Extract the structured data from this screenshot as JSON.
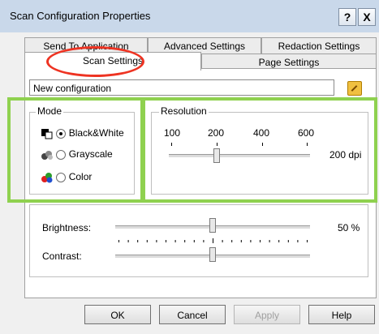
{
  "window": {
    "title": "Scan Configuration Properties",
    "help_label": "?",
    "close_label": "X"
  },
  "tabs": {
    "row1": [
      "Send To Application",
      "Advanced Settings",
      "Redaction Settings"
    ],
    "row2": [
      "Scan Settings",
      "Page Settings"
    ],
    "active": "Scan Settings"
  },
  "config_name": "New configuration",
  "mode": {
    "legend": "Mode",
    "options": [
      {
        "label": "Black&White",
        "selected": true,
        "icon": "bw-scan-icon"
      },
      {
        "label": "Grayscale",
        "selected": false,
        "icon": "grayscale-scan-icon"
      },
      {
        "label": "Color",
        "selected": false,
        "icon": "color-scan-icon"
      }
    ]
  },
  "resolution": {
    "legend": "Resolution",
    "tick_labels": [
      "100",
      "200",
      "400",
      "600"
    ],
    "value_label": "200 dpi",
    "value": 200
  },
  "brightness": {
    "label": "Brightness:",
    "value_label": "50 %",
    "value": 50
  },
  "contrast": {
    "label": "Contrast:",
    "value": 50
  },
  "buttons": {
    "ok": "OK",
    "cancel": "Cancel",
    "apply": "Apply",
    "help": "Help"
  },
  "colors": {
    "highlight_box": "#8fd14f",
    "highlight_oval": "#ee3322",
    "titlebar": "#c9d8ea"
  }
}
